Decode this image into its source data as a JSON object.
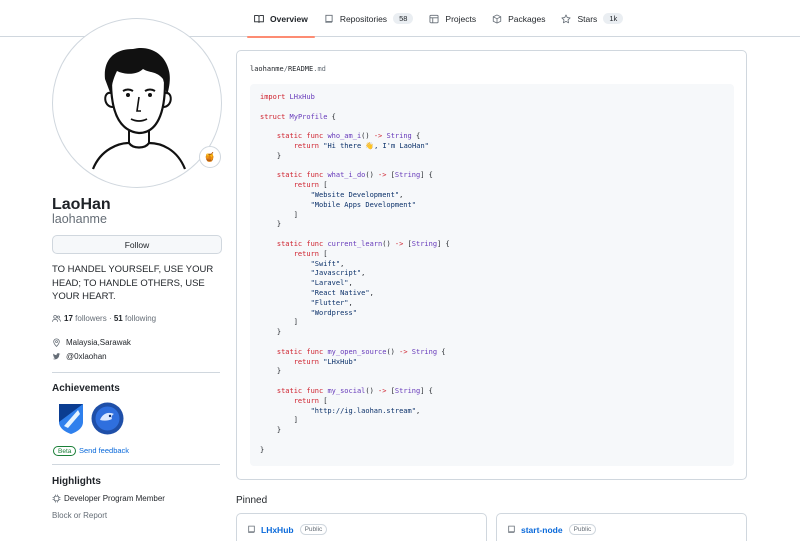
{
  "nav": {
    "tabs": [
      {
        "label": "Overview",
        "count": ""
      },
      {
        "label": "Repositories",
        "count": "58"
      },
      {
        "label": "Projects",
        "count": ""
      },
      {
        "label": "Packages",
        "count": ""
      },
      {
        "label": "Stars",
        "count": "1k"
      }
    ],
    "active_color": "#fd8c73"
  },
  "profile": {
    "status_emoji": "🍯",
    "name": "LaoHan",
    "login": "laohanme",
    "follow_label": "Follow",
    "bio": "TO HANDEL YOURSELF, USE YOUR HEAD; TO HANDLE OTHERS, USE YOUR HEART.",
    "followers_count": "17",
    "followers_label": "followers",
    "separator": "·",
    "following_count": "51",
    "following_label": "following",
    "location": "Malaysia,Sarawak",
    "twitter": "@0xlaohan"
  },
  "achievements": {
    "title": "Achievements",
    "beta_label": "Beta",
    "feedback_label": "Send feedback"
  },
  "highlights": {
    "title": "Highlights",
    "item": "Developer Program Member",
    "block_label": "Block or Report"
  },
  "readme": {
    "owner": "laohanme",
    "sep": "/",
    "file": "README",
    "ext": ".md",
    "code_lines": [
      [
        [
          "kw",
          "import"
        ],
        [
          "t",
          " "
        ],
        [
          "ty",
          "LHxHub"
        ]
      ],
      [],
      [
        [
          "kw",
          "struct"
        ],
        [
          "t",
          " "
        ],
        [
          "ty",
          "MyProfile"
        ],
        [
          "t",
          " {"
        ]
      ],
      [],
      [
        [
          "t",
          "    "
        ],
        [
          "kw",
          "static"
        ],
        [
          "t",
          " "
        ],
        [
          "kw",
          "func"
        ],
        [
          "t",
          " "
        ],
        [
          "fn",
          "who_am_i"
        ],
        [
          "t",
          "() "
        ],
        [
          "kw",
          "->"
        ],
        [
          "t",
          " "
        ],
        [
          "ty",
          "String"
        ],
        [
          "t",
          " {"
        ]
      ],
      [
        [
          "t",
          "        "
        ],
        [
          "kw",
          "return"
        ],
        [
          "t",
          " "
        ],
        [
          "st",
          "\"Hi there 👋, I'm LaoHan\""
        ]
      ],
      [
        [
          "t",
          "    }"
        ]
      ],
      [],
      [
        [
          "t",
          "    "
        ],
        [
          "kw",
          "static"
        ],
        [
          "t",
          " "
        ],
        [
          "kw",
          "func"
        ],
        [
          "t",
          " "
        ],
        [
          "fn",
          "what_i_do"
        ],
        [
          "t",
          "() "
        ],
        [
          "kw",
          "->"
        ],
        [
          "t",
          " ["
        ],
        [
          "ty",
          "String"
        ],
        [
          "t",
          "] {"
        ]
      ],
      [
        [
          "t",
          "        "
        ],
        [
          "kw",
          "return"
        ],
        [
          "t",
          " ["
        ]
      ],
      [
        [
          "t",
          "            "
        ],
        [
          "st",
          "\"Website Development\""
        ],
        [
          "t",
          ","
        ]
      ],
      [
        [
          "t",
          "            "
        ],
        [
          "st",
          "\"Mobile Apps Development\""
        ]
      ],
      [
        [
          "t",
          "        ]"
        ]
      ],
      [
        [
          "t",
          "    }"
        ]
      ],
      [],
      [
        [
          "t",
          "    "
        ],
        [
          "kw",
          "static"
        ],
        [
          "t",
          " "
        ],
        [
          "kw",
          "func"
        ],
        [
          "t",
          " "
        ],
        [
          "fn",
          "current_learn"
        ],
        [
          "t",
          "() "
        ],
        [
          "kw",
          "->"
        ],
        [
          "t",
          " ["
        ],
        [
          "ty",
          "String"
        ],
        [
          "t",
          "] {"
        ]
      ],
      [
        [
          "t",
          "        "
        ],
        [
          "kw",
          "return"
        ],
        [
          "t",
          " ["
        ]
      ],
      [
        [
          "t",
          "            "
        ],
        [
          "st",
          "\"Swift\""
        ],
        [
          "t",
          ","
        ]
      ],
      [
        [
          "t",
          "            "
        ],
        [
          "st",
          "\"Javascript\""
        ],
        [
          "t",
          ","
        ]
      ],
      [
        [
          "t",
          "            "
        ],
        [
          "st",
          "\"Laravel\""
        ],
        [
          "t",
          ","
        ]
      ],
      [
        [
          "t",
          "            "
        ],
        [
          "st",
          "\"React Native\""
        ],
        [
          "t",
          ","
        ]
      ],
      [
        [
          "t",
          "            "
        ],
        [
          "st",
          "\"Flutter\""
        ],
        [
          "t",
          ","
        ]
      ],
      [
        [
          "t",
          "            "
        ],
        [
          "st",
          "\"Wordpress\""
        ]
      ],
      [
        [
          "t",
          "        ]"
        ]
      ],
      [
        [
          "t",
          "    }"
        ]
      ],
      [],
      [
        [
          "t",
          "    "
        ],
        [
          "kw",
          "static"
        ],
        [
          "t",
          " "
        ],
        [
          "kw",
          "func"
        ],
        [
          "t",
          " "
        ],
        [
          "fn",
          "my_open_source"
        ],
        [
          "t",
          "() "
        ],
        [
          "kw",
          "->"
        ],
        [
          "t",
          " "
        ],
        [
          "ty",
          "String"
        ],
        [
          "t",
          " {"
        ]
      ],
      [
        [
          "t",
          "        "
        ],
        [
          "kw",
          "return"
        ],
        [
          "t",
          " "
        ],
        [
          "st",
          "\"LHxHub\""
        ]
      ],
      [
        [
          "t",
          "    }"
        ]
      ],
      [],
      [
        [
          "t",
          "    "
        ],
        [
          "kw",
          "static"
        ],
        [
          "t",
          " "
        ],
        [
          "kw",
          "func"
        ],
        [
          "t",
          " "
        ],
        [
          "fn",
          "my_social"
        ],
        [
          "t",
          "() "
        ],
        [
          "kw",
          "->"
        ],
        [
          "t",
          " ["
        ],
        [
          "ty",
          "String"
        ],
        [
          "t",
          "] {"
        ]
      ],
      [
        [
          "t",
          "        "
        ],
        [
          "kw",
          "return"
        ],
        [
          "t",
          " ["
        ]
      ],
      [
        [
          "t",
          "            "
        ],
        [
          "st",
          "\"http://ig.laohan.stream\""
        ],
        [
          "t",
          ","
        ]
      ],
      [
        [
          "t",
          "        ]"
        ]
      ],
      [
        [
          "t",
          "    }"
        ]
      ],
      [],
      [
        [
          "t",
          "}"
        ]
      ]
    ]
  },
  "pinned": {
    "title": "Pinned",
    "repos": [
      {
        "name": "LHxHub",
        "visibility": "Public"
      },
      {
        "name": "start-node",
        "visibility": "Public"
      }
    ]
  }
}
